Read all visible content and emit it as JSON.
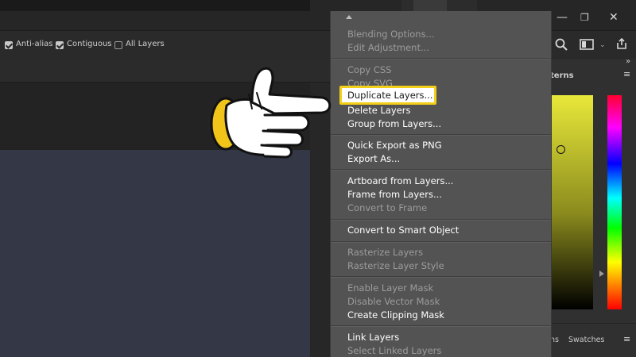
{
  "options_bar": {
    "anti_alias": {
      "label": "Anti-alias",
      "checked": true
    },
    "contiguous": {
      "label": "Contiguous",
      "checked": true
    },
    "all_layers": {
      "label": "All Layers",
      "checked": false
    }
  },
  "right_panel": {
    "tab_partial": "terns",
    "collapse_glyph": "»",
    "footer_tab_partial": "ns",
    "footer_tab": "Swatches",
    "icons": [
      "search-icon",
      "workspace-icon",
      "share-icon",
      "panel-menu-icon"
    ],
    "colors": {
      "field_top": "#e8e83a",
      "hue_top": "#ff0030"
    }
  },
  "window_controls": [
    "minimize-icon",
    "restore-icon",
    "close-icon"
  ],
  "context_menu": {
    "groups": [
      [
        {
          "label": "Blending Options...",
          "enabled": false
        },
        {
          "label": "Edit Adjustment...",
          "enabled": false
        }
      ],
      [
        {
          "label": "Copy CSS",
          "enabled": false
        },
        {
          "label": "Copy SVG",
          "enabled": false
        },
        {
          "label": "Duplicate Layers...",
          "enabled": true,
          "highlighted": true
        },
        {
          "label": "Delete Layers",
          "enabled": true
        },
        {
          "label": "Group from Layers...",
          "enabled": true
        }
      ],
      [
        {
          "label": "Quick Export as PNG",
          "enabled": true
        },
        {
          "label": "Export As...",
          "enabled": true
        }
      ],
      [
        {
          "label": "Artboard from Layers...",
          "enabled": true
        },
        {
          "label": "Frame from Layers...",
          "enabled": true
        },
        {
          "label": "Convert to Frame",
          "enabled": false
        }
      ],
      [
        {
          "label": "Convert to Smart Object",
          "enabled": true
        }
      ],
      [
        {
          "label": "Rasterize Layers",
          "enabled": false
        },
        {
          "label": "Rasterize Layer Style",
          "enabled": false
        }
      ],
      [
        {
          "label": "Enable Layer Mask",
          "enabled": false
        },
        {
          "label": "Disable Vector Mask",
          "enabled": false
        },
        {
          "label": "Create Clipping Mask",
          "enabled": true
        }
      ],
      [
        {
          "label": "Link Layers",
          "enabled": true
        },
        {
          "label": "Select Linked Layers",
          "enabled": false
        }
      ]
    ],
    "highlight_color": "#f3cf1a"
  },
  "pointer": {
    "icon": "pointing-hand-icon"
  }
}
